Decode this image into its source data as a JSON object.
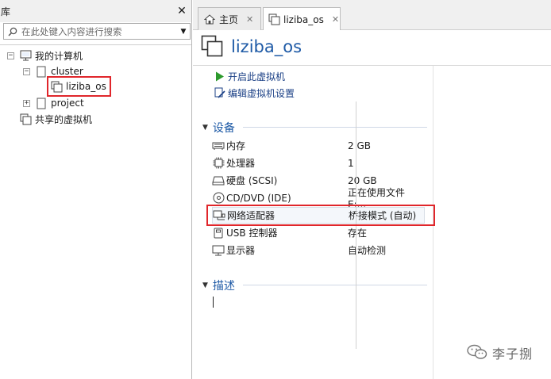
{
  "library": {
    "title": "库",
    "close_glyph": "✕",
    "search": {
      "placeholder": "在此处键入内容进行搜索",
      "value": ""
    },
    "tree": {
      "root": {
        "label": "我的计算机",
        "expander": "⊟"
      },
      "cluster": {
        "label": "cluster",
        "expander": "⊟"
      },
      "vm": {
        "label": "liziba_os"
      },
      "project": {
        "label": "project",
        "expander": "⊞"
      },
      "shared": {
        "label": "共享的虚拟机"
      }
    }
  },
  "tabs": [
    {
      "label": "主页",
      "close": "✕",
      "icon": "home-icon"
    },
    {
      "label": "liziba_os",
      "close": "✕",
      "icon": "vm-icon",
      "active": true
    }
  ],
  "vm": {
    "title": "liziba_os",
    "commands": {
      "power_on": "开启此虚拟机",
      "edit_settings": "编辑虚拟机设置"
    },
    "devices_section": {
      "title": "设备",
      "toggle": "▼"
    },
    "devices": [
      {
        "name": "内存",
        "value": "2 GB",
        "icon": "memory-icon"
      },
      {
        "name": "处理器",
        "value": "1",
        "icon": "cpu-icon"
      },
      {
        "name": "硬盘 (SCSI)",
        "value": "20 GB",
        "icon": "harddisk-icon"
      },
      {
        "name": "CD/DVD (IDE)",
        "value": "正在使用文件 E:...",
        "icon": "cd-dvd-icon"
      },
      {
        "name": "网络适配器",
        "value": "桥接模式 (自动)",
        "icon": "network-adapter-icon"
      },
      {
        "name": "USB 控制器",
        "value": "存在",
        "icon": "usb-icon"
      },
      {
        "name": "显示器",
        "value": "自动检测",
        "icon": "monitor-icon"
      }
    ],
    "description_section": {
      "title": "描述",
      "toggle": "▼"
    }
  },
  "watermark": {
    "text": "李子捌"
  },
  "colors": {
    "accent": "#1e5aa6",
    "highlight": "#e0262b",
    "play": "#2d9a2d"
  }
}
